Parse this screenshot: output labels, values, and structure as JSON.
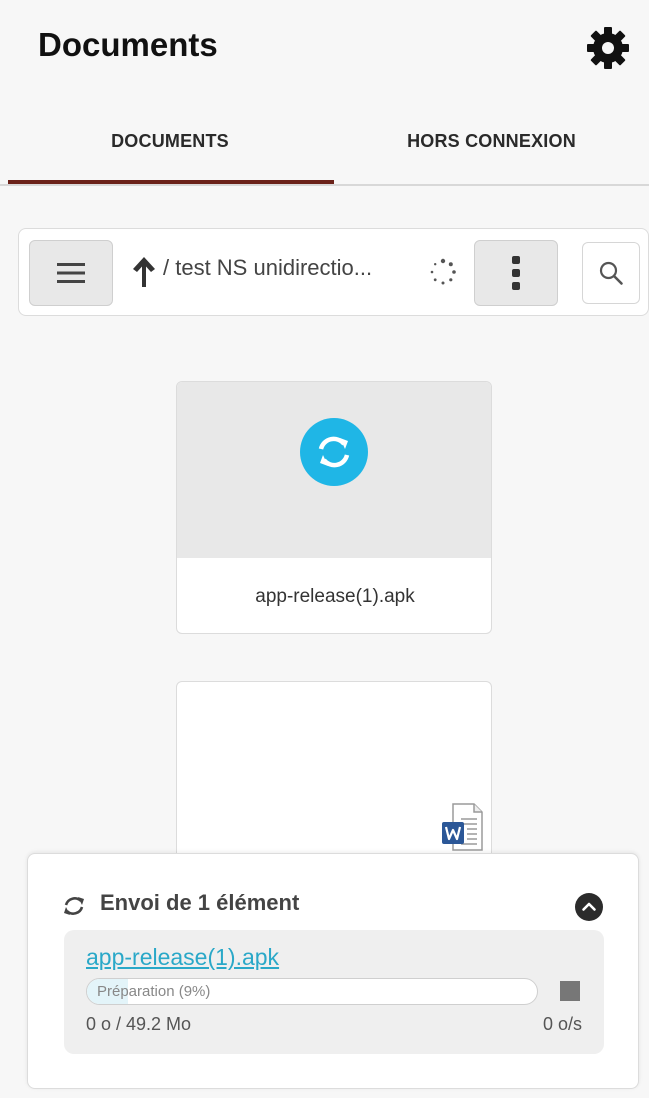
{
  "header": {
    "title": "Documents",
    "settings_icon": "gear-icon"
  },
  "tabs": [
    {
      "label": "DOCUMENTS",
      "active": true
    },
    {
      "label": "HORS CONNEXION",
      "active": false
    }
  ],
  "toolbar": {
    "menu_icon": "hamburger-icon",
    "up_icon": "arrow-up-icon",
    "path": "/ test NS unidirectio...",
    "loading_icon": "spinner-icon",
    "more_icon": "vertical-dots-icon",
    "search_icon": "search-icon"
  },
  "files": [
    {
      "name": "app-release(1).apk",
      "status_icon": "sync-icon",
      "status_color": "#1fb6e6"
    },
    {
      "name": "",
      "type_icon": "word-document-icon"
    }
  ],
  "upload": {
    "title": "Envoi de 1 élément",
    "header_icon": "sync-icon",
    "collapse_icon": "chevron-up-icon",
    "item": {
      "filename": "app-release(1).apk",
      "status": "Préparation (9%)",
      "progress": 0.09,
      "size": "0 o / 49.2 Mo",
      "speed": "0 o/s",
      "stop_icon": "stop-icon"
    }
  },
  "colors": {
    "accent": "#6b2219",
    "link": "#2aa8c8",
    "sync": "#1fb6e6"
  }
}
